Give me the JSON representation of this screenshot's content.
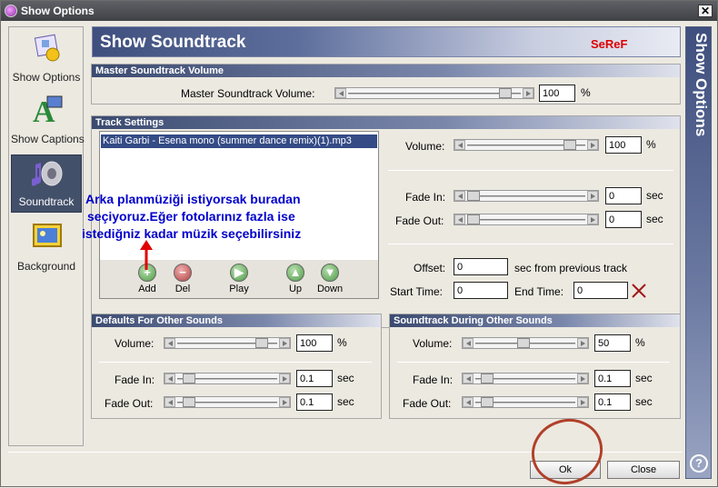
{
  "window": {
    "title": "Show Options"
  },
  "sidebar": {
    "items": [
      {
        "label": "Show Options"
      },
      {
        "label": "Show Captions"
      },
      {
        "label": "Soundtrack"
      },
      {
        "label": "Background"
      }
    ]
  },
  "header": {
    "title": "Show Soundtrack",
    "signature": "SeReF"
  },
  "right_tab": {
    "label": "Show Options"
  },
  "master": {
    "panel_title": "Master Soundtrack Volume",
    "label": "Master Soundtrack Volume:",
    "value": "100",
    "unit": "%",
    "level": 1.0
  },
  "track": {
    "panel_title": "Track Settings",
    "list": [
      "Kaiti Garbi - Esena mono (summer dance remix)(1).mp3"
    ],
    "buttons": {
      "add": "Add",
      "del": "Del",
      "play": "Play",
      "up": "Up",
      "down": "Down"
    },
    "volume_label": "Volume:",
    "volume_value": "100",
    "volume_unit": "%",
    "fade_in_label": "Fade In:",
    "fade_in_value": "0",
    "fade_out_label": "Fade Out:",
    "fade_out_value": "0",
    "sec": "sec",
    "offset_label": "Offset:",
    "offset_value": "0",
    "offset_suffix": "sec from previous track",
    "start_label": "Start Time:",
    "start_value": "0",
    "end_label": "End Time:",
    "end_value": "0"
  },
  "defaults": {
    "panel_title": "Defaults For Other Sounds",
    "volume_label": "Volume:",
    "volume_value": "100",
    "unit": "%",
    "fade_in_label": "Fade In:",
    "fade_in_value": "0.1",
    "fade_out_label": "Fade Out:",
    "fade_out_value": "0.1",
    "sec": "sec"
  },
  "during": {
    "panel_title": "Soundtrack During Other Sounds",
    "volume_label": "Volume:",
    "volume_value": "50",
    "unit": "%",
    "fade_in_label": "Fade In:",
    "fade_in_value": "0.1",
    "fade_out_label": "Fade Out:",
    "fade_out_value": "0.1",
    "sec": "sec"
  },
  "annotation": {
    "line1": "Arka planmüziği istiyorsak buradan",
    "line2": "seçiyoruz.Eğer fotolarınız fazla ise",
    "line3": "istediğniz kadar müzik seçebilirsiniz"
  },
  "footer": {
    "ok": "Ok",
    "close": "Close",
    "help": "?"
  },
  "colors": {
    "accent": "#3f4f7e",
    "signature": "#e00000",
    "annotation": "#0000cc",
    "circle": "#b0402a"
  }
}
